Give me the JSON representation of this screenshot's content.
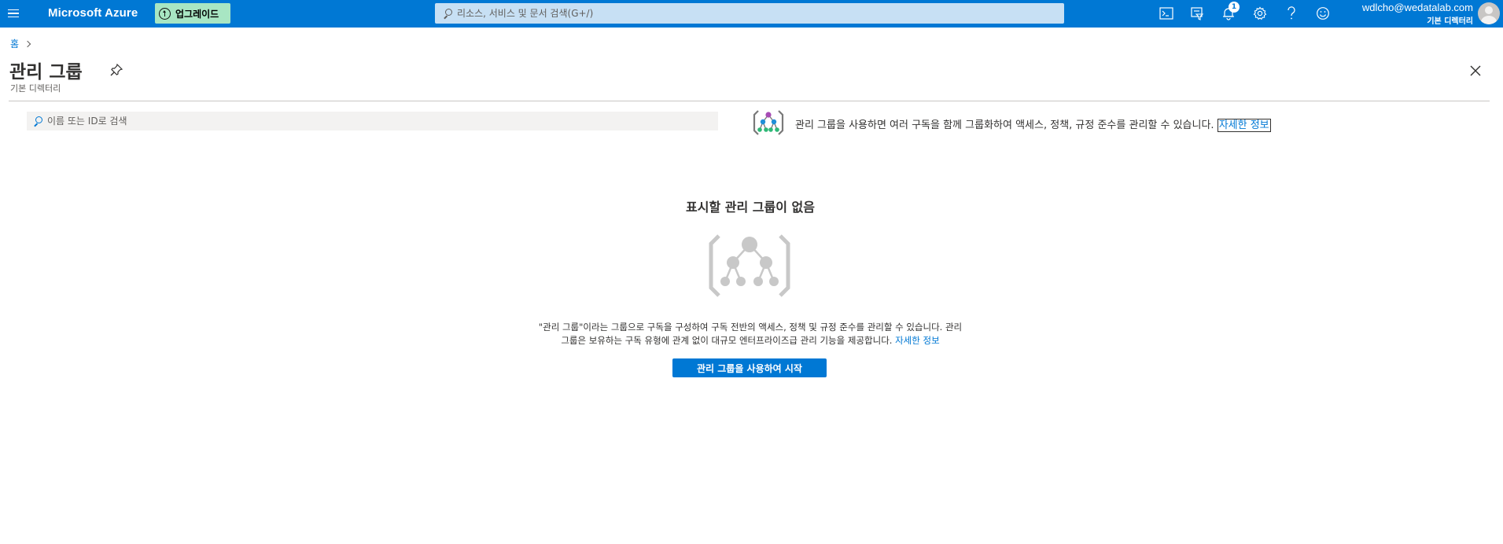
{
  "topbar": {
    "brand": "Microsoft Azure",
    "upgrade_label": "업그레이드",
    "search_placeholder": "리소스, 서비스 및 문서 검색(G+/)",
    "notification_count": "1",
    "account_email": "wdlcho@wedatalab.com",
    "account_directory": "기본 디렉터리",
    "icons": [
      "menu-icon",
      "cloud-shell-icon",
      "directory-filter-icon",
      "notifications-icon",
      "settings-icon",
      "help-icon",
      "feedback-icon"
    ]
  },
  "breadcrumb": {
    "home": "홈"
  },
  "page": {
    "title": "관리 그룹",
    "subtitle": "기본 디렉터리"
  },
  "filter": {
    "placeholder": "이름 또는 ID로 검색"
  },
  "info_banner": {
    "text": "관리 그룹을 사용하면 여러 구독을 함께 그룹화하여 액세스, 정책, 규정 준수를 관리할 수 있습니다.",
    "link": "자세한 정보"
  },
  "empty_state": {
    "title": "표시할 관리 그룹이 없음",
    "description_line1": "\"관리 그룹\"이라는 그룹으로 구독을 구성하여 구독 전반의 액세스, 정책 및 규정 준수를 관리할 수 있습니다. 관리",
    "description_line2": "그룹은 보유하는 구독 유형에 관계 없이 대규모 엔터프라이즈급 관리 기능을 제공합니다.",
    "link": "자세한 정보",
    "button": "관리 그룹을 사용하여 시작"
  },
  "colors": {
    "accent": "#0078d4",
    "upgrade_bg": "#a8e6c3",
    "search_bg": "#c7e0f4"
  }
}
